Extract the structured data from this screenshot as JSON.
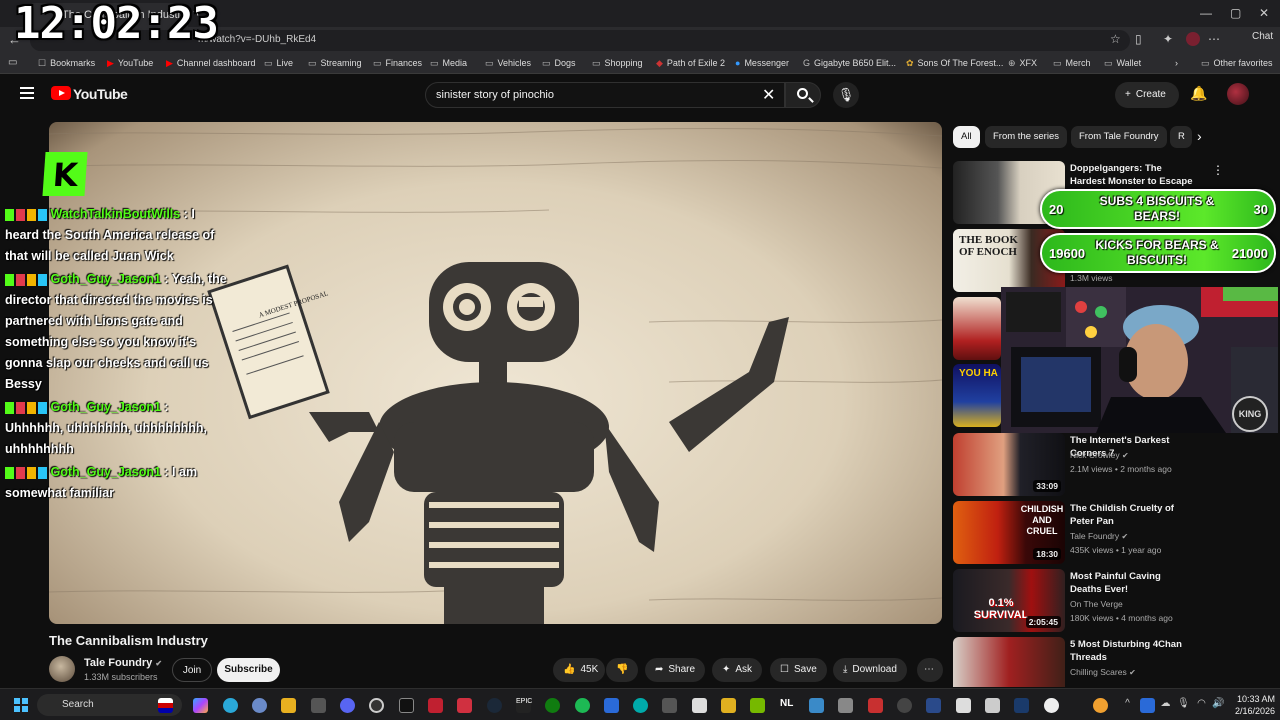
{
  "browser": {
    "tab_title": "The Cannibalism Industry",
    "url": "m/watch?v=-DUhb_RkEd4",
    "chat_label": "Chat",
    "bookmarks": [
      "Bookmarks",
      "YouTube",
      "Channel dashboard",
      "Live",
      "Streaming",
      "Finances",
      "Media",
      "Vehicles",
      "Dogs",
      "Shopping",
      "Path of Exile 2",
      "Messenger",
      "Gigabyte B650 Elit...",
      "Sons Of The Forest...",
      "XFX",
      "Merch",
      "Wallet",
      "Other favorites"
    ]
  },
  "stream_clock": "12:02:23",
  "youtube": {
    "logo_text": "YouTube",
    "search_value": "sinister story of pinochio",
    "create_label": "Create"
  },
  "video": {
    "title": "The Cannibalism Industry",
    "channel": "Tale Foundry",
    "subscribers": "1.33M subscribers",
    "join_label": "Join",
    "subscribe_label": "Subscribe",
    "likes": "45K",
    "share_label": "Share",
    "ask_label": "Ask",
    "save_label": "Save",
    "download_label": "Download",
    "book_title": "A MODEST PROPOSAL"
  },
  "chat": [
    {
      "user": "WatchTalkinBoutWills",
      "text": "I heard the South America release of that will be called Juan Wick"
    },
    {
      "user": "Goth_Guy_Jason1",
      "text": "Yeah, the director that directed the movies is partnered with Lions gate and something else so you know it's gonna slap our cheeks and call us Bessy"
    },
    {
      "user": "Goth_Guy_Jason1",
      "text": "Uhhhhhh, uhhhhhhh, uhhhhhhhh, uhhhhhhhh"
    },
    {
      "user": "Goth_Guy_Jason1",
      "text": "I am somewhat familiar"
    }
  ],
  "sidebar": {
    "chips": [
      "All",
      "From the series",
      "From Tale Foundry",
      "R"
    ],
    "recs": [
      {
        "title": "Doppelgangers: The Hardest Monster to Escape",
        "channel": "",
        "meta": "",
        "duration": ""
      },
      {
        "title": "",
        "channel": "",
        "meta": "1.3M views",
        "duration": "",
        "thumb_text": "THE BOOK OF ENOCH"
      },
      {
        "title": "",
        "channel": "",
        "meta": "",
        "duration": ""
      },
      {
        "title": "",
        "channel": "",
        "meta": "",
        "duration": "",
        "thumb_text": "YOU HA"
      },
      {
        "title": "The Internet's Darkest Corners 7",
        "channel": "Nick Crowley",
        "meta": "2.1M views • 2 months ago",
        "duration": "33:09"
      },
      {
        "title": "The Childish Cruelty of Peter Pan",
        "channel": "Tale Foundry",
        "meta": "435K views • 1 year ago",
        "duration": "18:30",
        "thumb_text": "CHILDISH AND CRUEL"
      },
      {
        "title": "Most Painful Caving Deaths Ever!",
        "channel": "On The Verge",
        "meta": "180K views • 4 months ago",
        "duration": "2:05:45",
        "thumb_text": "0.1% SURVIVAL"
      },
      {
        "title": "5 Most Disturbing 4Chan Threads",
        "channel": "Chilling Scares",
        "meta": "",
        "duration": ""
      }
    ]
  },
  "goals": [
    {
      "left": "20",
      "text": "SUBS 4 BISCUITS & BEARS!",
      "right": "30"
    },
    {
      "left": "19600",
      "text": "KICKS FOR BEARS & BISCUITS!",
      "right": "21000"
    }
  ],
  "webcam_badge": "KING",
  "taskbar": {
    "search_label": "Search",
    "time": "10:33 AM",
    "date": "2/16/2026"
  },
  "colors": {
    "kick_green": "#53fc18",
    "yt_red": "#ff0000",
    "bg": "#0f0f0f"
  }
}
